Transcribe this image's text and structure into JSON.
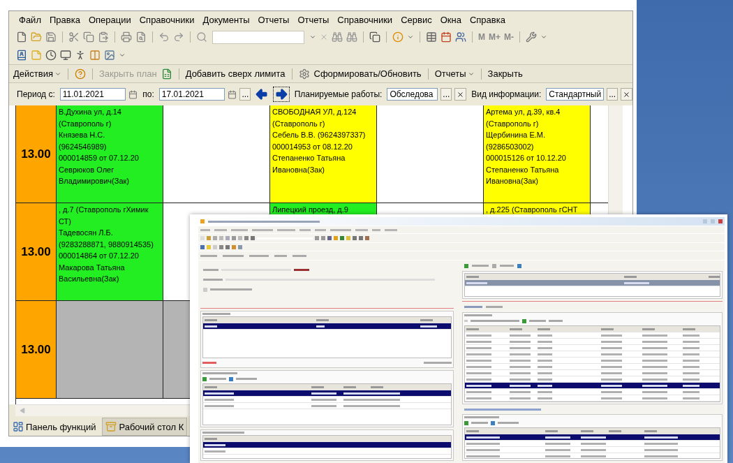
{
  "menu": [
    "Файл",
    "Правка",
    "Операции",
    "Справочники",
    "Документы",
    "Отчеты",
    "Отчеты",
    "Справочники",
    "Сервис",
    "Окна",
    "Справка"
  ],
  "memory_buttons": [
    "M",
    "M+",
    "M-"
  ],
  "actions": [
    {
      "kind": "menu",
      "label": "Действия",
      "disabled": false
    },
    {
      "kind": "button",
      "label": "Закрыть план",
      "disabled": true
    },
    {
      "kind": "button",
      "label": "Добавить сверх лимита",
      "disabled": false
    },
    {
      "kind": "button",
      "label": "Сформировать/Обновить",
      "disabled": false
    },
    {
      "kind": "menu",
      "label": "Отчеты",
      "disabled": false
    },
    {
      "kind": "button",
      "label": "Закрыть",
      "disabled": false
    }
  ],
  "filters": {
    "period_from": {
      "label": "Период с:",
      "value": "11.01.2021"
    },
    "period_to": {
      "label": "по:",
      "value": "17.01.2021"
    },
    "more_button": "...",
    "planned_works": {
      "label": "Планируемые работы:",
      "value": "Обследова",
      "select_button": "..."
    },
    "info_kind": {
      "label": "Вид информации:",
      "value": "Стандартный",
      "select_button": "..."
    }
  },
  "schedule": {
    "rows": [
      {
        "time": "13.00",
        "cells": [
          {
            "color": "#22ee22",
            "text": "В.Духина ул, д.14\n(Ставрополь г)\nКнязева Н.С.\n(9624546989)\n000014859 от 07.12.20\nСеврюков Олег\nВладимирович(Зак)"
          },
          {
            "color": "#ffffff"
          },
          {
            "color": "#ffff00",
            "text": "СВОБОДНАЯ УЛ, д.124\n(Ставрополь г)\nСебель В.В. (9624397337)\n000014953 от 08.12.20\nСтепаненко Татьяна\nИвановна(Зак)"
          },
          {
            "color": "#ffffff"
          },
          {
            "color": "#ffff00",
            "text": "Артема ул, д.39, кв.4\n(Ставрополь г)\nЩербинина Е.М.\n(9286503002)\n000015126 от 10.12.20\nСтепаненко Татьяна\nИвановна(Зак)"
          }
        ]
      },
      {
        "time": "13.00",
        "cells": [
          {
            "color": "#22ee22",
            "text": ", д.7 (Ставрополь гХимик\nСТ)\nТадевосян Л.Б.\n(9283288871, 9880914535)\n000014864 от 07.12.20\nМакарова Татьяна\nВасильевна(Зак)"
          },
          {
            "color": "#ffffff"
          },
          {
            "color": "#22ee22",
            "text": "Липецкий проезд, д.9"
          },
          {
            "color": "#ffffff"
          },
          {
            "color": "#ffff00",
            "text": ", д.225 (Ставрополь гСНТ"
          }
        ]
      },
      {
        "time": "13.00",
        "cells": [
          {
            "color": "#b4b4b4"
          },
          {
            "color": "#b4b4b4"
          }
        ]
      }
    ]
  },
  "taskbar": [
    {
      "label": "Панель функций",
      "selected": false
    },
    {
      "label": "Рабочий стол К",
      "selected": true
    }
  ],
  "inset": {
    "tables": [
      {
        "rows": [
          {
            "selected": true
          }
        ]
      },
      {
        "rows": [
          {
            "selected": true
          },
          {
            "selected": false
          },
          {
            "selected": false
          }
        ]
      },
      {
        "rows": [
          {
            "selected": true
          },
          {
            "selected": false
          }
        ]
      },
      {
        "rows": [
          {
            "selected": true
          }
        ]
      },
      {
        "rows": [
          {
            "selected": false
          },
          {
            "selected": false
          },
          {
            "selected": false
          },
          {
            "selected": false
          },
          {
            "selected": false
          },
          {
            "selected": false
          },
          {
            "selected": false
          },
          {
            "selected": false
          },
          {
            "selected": true
          },
          {
            "selected": false
          },
          {
            "selected": false
          }
        ]
      },
      {
        "rows": [
          {
            "selected": true
          },
          {
            "selected": false
          },
          {
            "selected": false
          },
          {
            "selected": false
          }
        ]
      }
    ]
  }
}
